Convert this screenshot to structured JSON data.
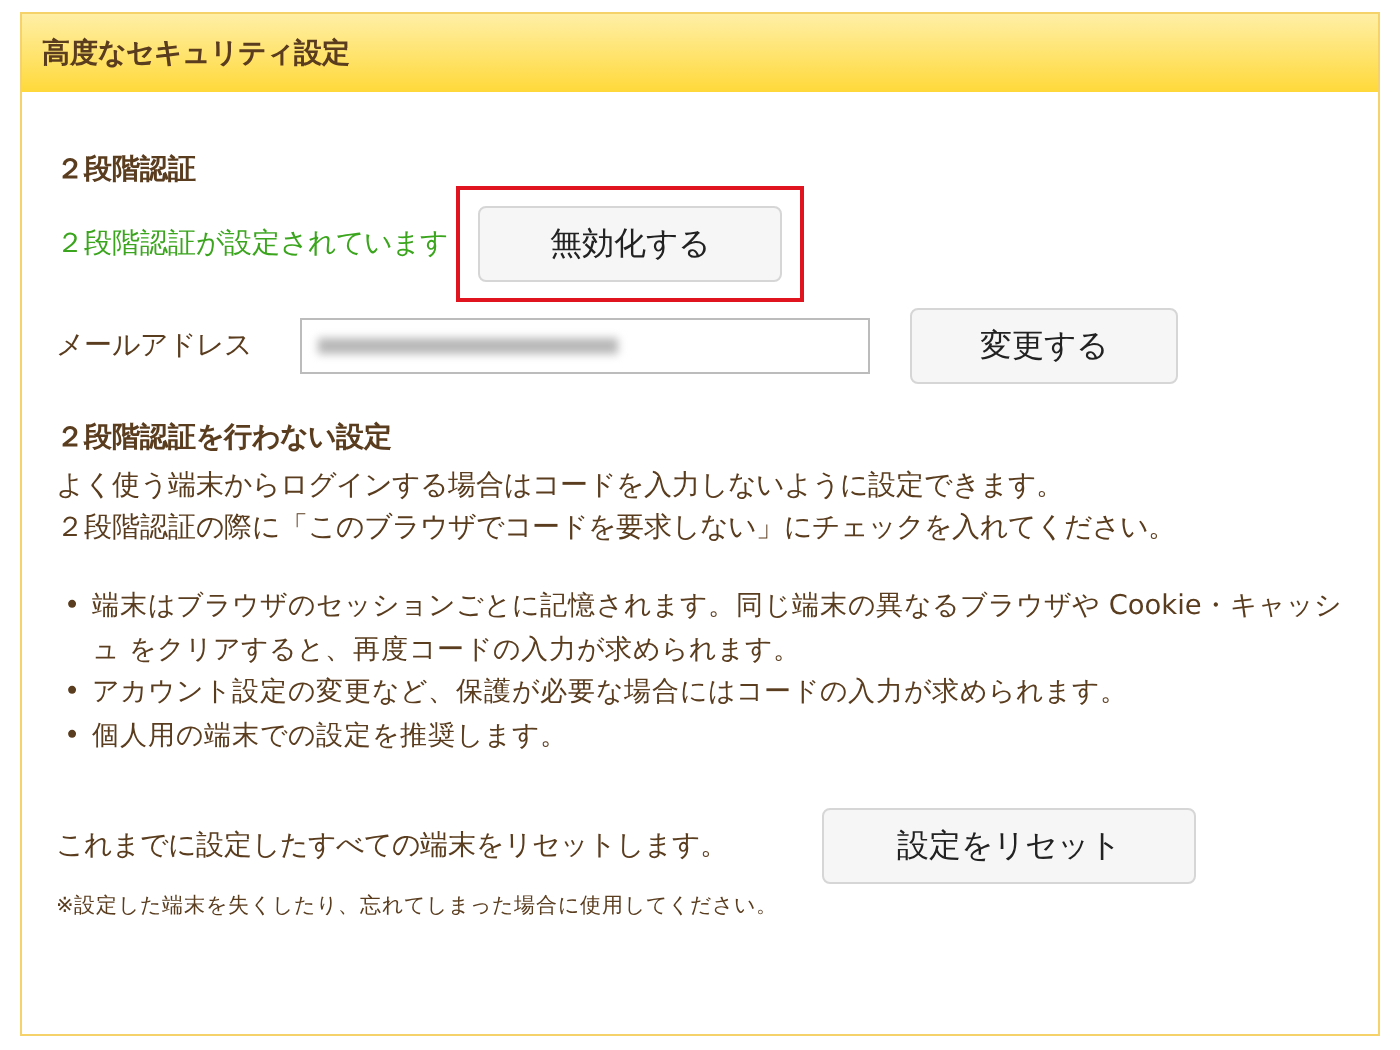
{
  "panel": {
    "title": "高度なセキュリティ設定"
  },
  "two_factor": {
    "heading": "２段階認証",
    "status": "２段階認証が設定されています",
    "disable_button": {
      "label": "無効化する",
      "highlighted": true
    },
    "email": {
      "label": "メールアドレス",
      "change_button": "変更する"
    }
  },
  "skip_settings": {
    "heading": "２段階認証を行わない設定",
    "intro": [
      "よく使う端末からログインする場合はコードを入力しないように設定できます。",
      "２段階認証の際に「このブラウザでコードを要求しない」にチェックを入れてください。"
    ],
    "bullets": [
      {
        "marker": "•",
        "text": "端末はブラウザのセッションごとに記憶されます。同じ端末の異なるブラウザや Cookie・キャッシュ をクリアすると、再度コードの入力が求められます。"
      },
      {
        "marker": "•",
        "text": "アカウント設定の変更など、保護が必要な場合にはコードの入力が求められます。"
      },
      {
        "marker": "•",
        "text": "個人用の端末での設定を推奨します。"
      }
    ],
    "reset_text": "これまでに設定したすべての端末をリセットします。",
    "reset_button": "設定をリセット",
    "note": "※設定した端末を失くしたり、忘れてしまった場合に使用してください。"
  }
}
